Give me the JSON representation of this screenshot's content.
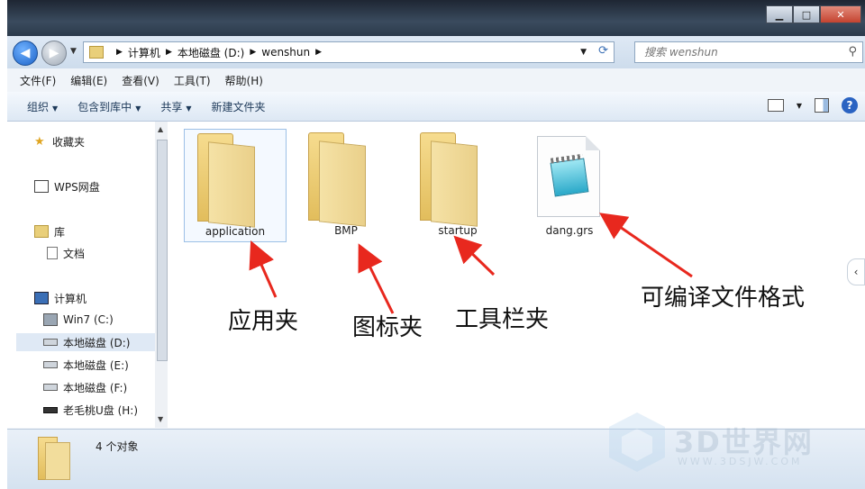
{
  "address": {
    "crumbs": [
      "计算机",
      "本地磁盘 (D:)",
      "wenshun"
    ]
  },
  "search": {
    "placeholder": "搜索 wenshun"
  },
  "menu": [
    "文件(F)",
    "编辑(E)",
    "查看(V)",
    "工具(T)",
    "帮助(H)"
  ],
  "toolbar": {
    "organize": "组织",
    "include_library": "包含到库中",
    "share": "共享",
    "new_folder": "新建文件夹"
  },
  "sidebar": {
    "favorites": "收藏夹",
    "wps": "WPS网盘",
    "library": "库",
    "documents": "文档",
    "computer": "计算机",
    "drives": [
      "Win7 (C:)",
      "本地磁盘 (D:)",
      "本地磁盘 (E:)",
      "本地磁盘 (F:)",
      "老毛桃U盘 (H:)"
    ]
  },
  "files": [
    {
      "name": "application",
      "type": "folder"
    },
    {
      "name": "BMP",
      "type": "folder"
    },
    {
      "name": "startup",
      "type": "folder"
    },
    {
      "name": "dang.grs",
      "type": "file"
    }
  ],
  "status": {
    "count": "4 个对象"
  },
  "annotations": {
    "app": "应用夹",
    "icon": "图标夹",
    "toolbar": "工具栏夹",
    "format": "可编译文件格式"
  },
  "watermark": {
    "brand": "3D世界网",
    "url": "WWW.3DSJW.COM"
  },
  "colors": {
    "accent": "#1d63c7",
    "arrow": "#e8281e",
    "folder": "#f2d27a"
  }
}
